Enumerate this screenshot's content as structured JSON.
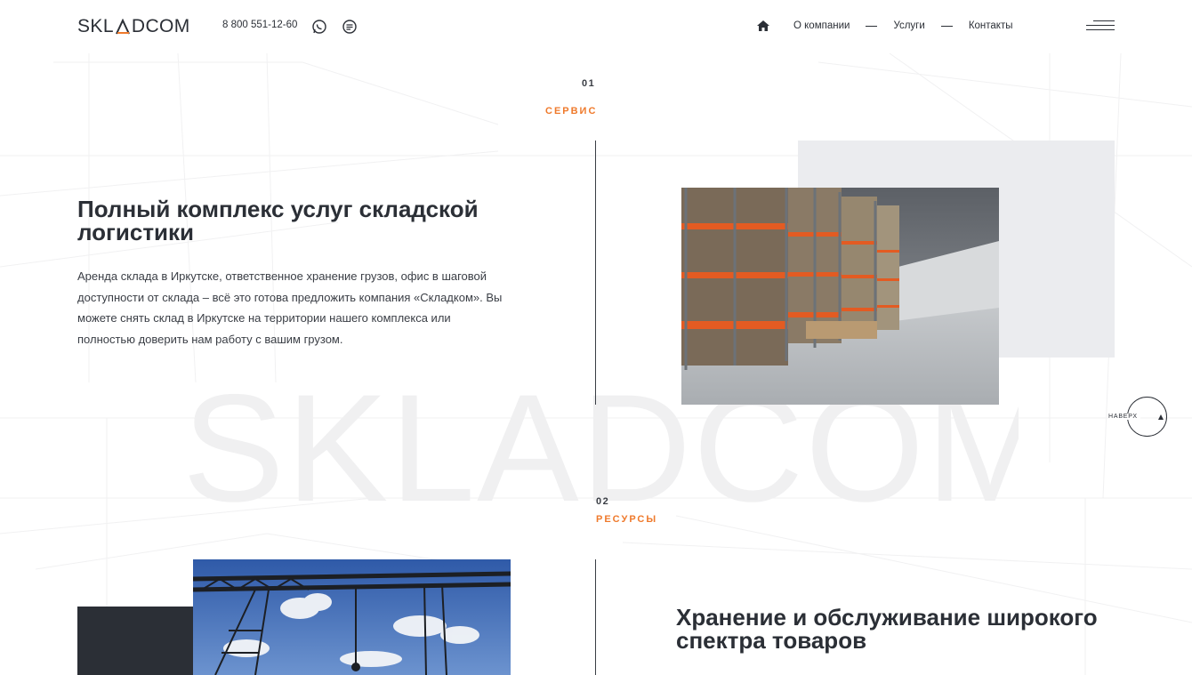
{
  "header": {
    "logo": {
      "part1": "SKL",
      "accent": "/\\",
      "part2": "DCOM"
    },
    "phone": "8 800 551-12-60",
    "nav": [
      "О компании",
      "Услуги",
      "Контакты"
    ]
  },
  "section1": {
    "number": "01",
    "label": "СЕРВИС",
    "title_line1": "Полный комплекс услуг складской",
    "title_line2": "логистики",
    "paragraph_lines": [
      "Аренда склада в Иркутске, ответственное хранение грузов, офис в шаговой",
      "доступности от склада – всё это готова предложить компания «Складком». Вы",
      "можете снять склад в Иркутске на территории нашего комплекса или",
      "полностью доверить нам работу с вашим грузом."
    ]
  },
  "section2": {
    "number": "02",
    "label": "РЕСУРСЫ",
    "title_line1": "Хранение и обслуживание широкого",
    "title_line2": "спектра товаров"
  },
  "watermark": "SKLADCOM",
  "to_top": "НАВЕРХ",
  "colors": {
    "accent": "#ef7a2c",
    "dark": "#2b2f36",
    "gray_block": "#ebecef"
  },
  "icons": [
    "whatsapp-icon",
    "chat-icon",
    "home-icon",
    "menu-icon",
    "arrow-up-icon"
  ]
}
